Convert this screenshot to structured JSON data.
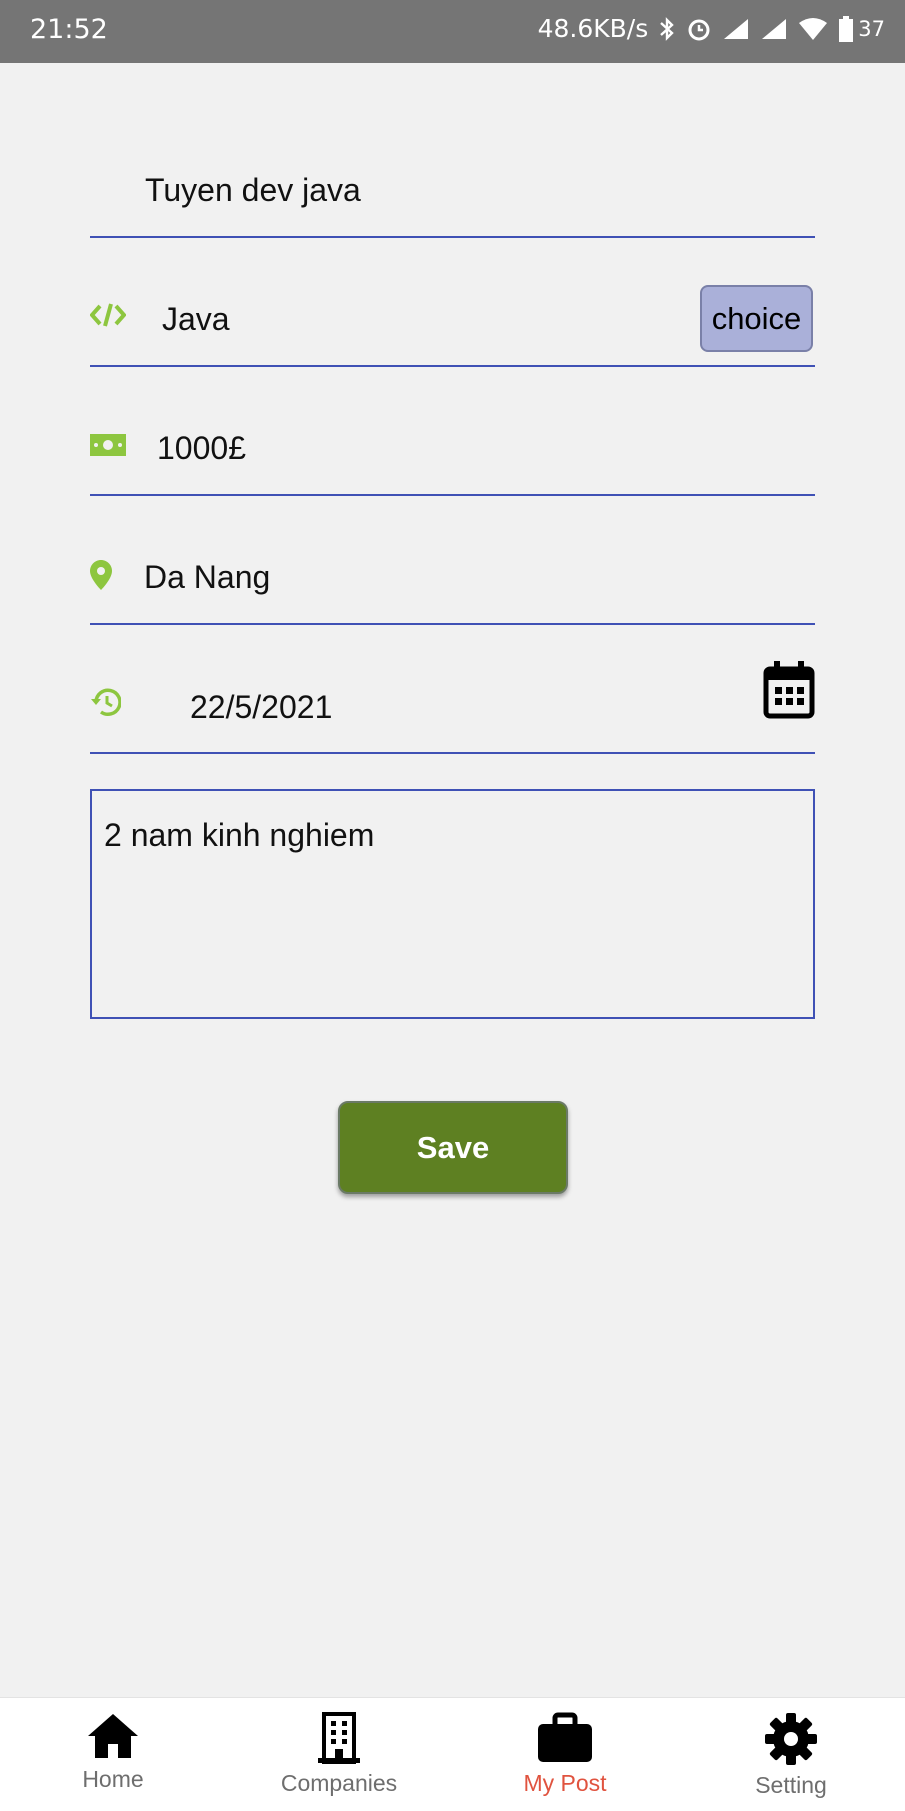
{
  "status_bar": {
    "time": "21:52",
    "network_speed": "48.6KB/s",
    "battery": "37"
  },
  "form": {
    "title_value": "Tuyen dev java",
    "skill_value": "Java",
    "choice_label": "choice",
    "salary_value": "1000£",
    "location_value": "Da Nang",
    "date_value": "22/5/2021",
    "description_value": "2 nam kinh nghiem",
    "save_label": "Save"
  },
  "bottom_nav": {
    "items": [
      {
        "label": "Home",
        "icon": "home-icon"
      },
      {
        "label": "Companies",
        "icon": "building-icon"
      },
      {
        "label": "My Post",
        "icon": "briefcase-icon"
      },
      {
        "label": "Setting",
        "icon": "gear-icon"
      }
    ],
    "active": "My Post"
  },
  "colors": {
    "accent_green": "#8dc63f",
    "underline": "#3f51b5",
    "save_button": "#5e8022",
    "active_nav": "#e0533f"
  }
}
